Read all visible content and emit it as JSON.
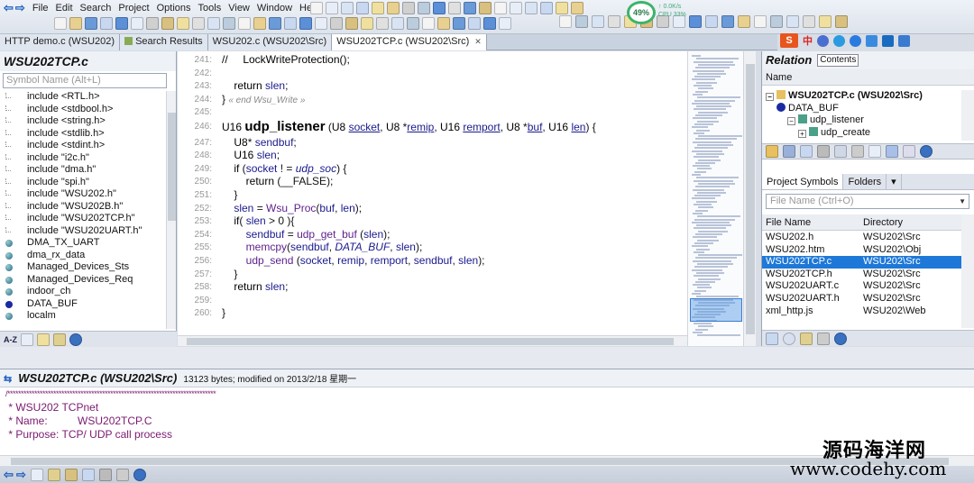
{
  "menu": [
    "File",
    "Edit",
    "Search",
    "Project",
    "Options",
    "Tools",
    "View",
    "Window",
    "Help"
  ],
  "gauge": {
    "percent": "49%",
    "net_up": "↑ 0.0K/s",
    "cpu": "CPU 33%"
  },
  "tabs": [
    {
      "label": "HTTP demo.c (WSU202)",
      "active": false,
      "has_icon": false
    },
    {
      "label": "Search Results",
      "active": false,
      "has_icon": true
    },
    {
      "label": "WSU202.c (WSU202\\Src)",
      "active": false,
      "has_icon": false
    },
    {
      "label": "WSU202TCP.c (WSU202\\Src)",
      "active": true,
      "has_icon": false
    }
  ],
  "symbol_panel": {
    "title": "WSU202TCP.c",
    "search_placeholder": "Symbol Name (Alt+L)",
    "items": [
      {
        "label": "include <RTL.h>",
        "kind": "inc"
      },
      {
        "label": "include <stdbool.h>",
        "kind": "inc"
      },
      {
        "label": "include <string.h>",
        "kind": "inc"
      },
      {
        "label": "include <stdlib.h>",
        "kind": "inc"
      },
      {
        "label": "include <stdint.h>",
        "kind": "inc"
      },
      {
        "label": "include \"i2c.h\"",
        "kind": "inc"
      },
      {
        "label": "include \"dma.h\"",
        "kind": "inc"
      },
      {
        "label": "include \"spi.h\"",
        "kind": "inc"
      },
      {
        "label": "include \"WSU202.h\"",
        "kind": "inc"
      },
      {
        "label": "include \"WSU202B.h\"",
        "kind": "inc"
      },
      {
        "label": "include \"WSU202TCP.h\"",
        "kind": "inc"
      },
      {
        "label": "include \"WSU202UART.h\"",
        "kind": "inc"
      },
      {
        "label": "DMA_TX_UART",
        "kind": "var"
      },
      {
        "label": "dma_rx_data",
        "kind": "var"
      },
      {
        "label": "Managed_Devices_Sts",
        "kind": "var"
      },
      {
        "label": "Managed_Devices_Req",
        "kind": "var"
      },
      {
        "label": "indoor_ch",
        "kind": "var"
      },
      {
        "label": "DATA_BUF",
        "kind": "fn"
      },
      {
        "label": "localm",
        "kind": "var"
      }
    ],
    "footer_label": "A-Z"
  },
  "editor": {
    "lines": [
      {
        "n": "241:",
        "html": "<span class='kw'>//     LockWriteProtection();</span>"
      },
      {
        "n": "242:",
        "html": ""
      },
      {
        "n": "243:",
        "html": "    <span class='kw'>return</span> <span class='id'>slen</span>;"
      },
      {
        "n": "244:",
        "html": "} <span class='grey'>« end Wsu_Write »</span>"
      },
      {
        "n": "245:",
        "html": ""
      },
      {
        "n": "246:",
        "html": "<span class='kw'>U16</span> <span class='fn-name'>udp_listener</span> (<span class='kw'>U8</span> <span class='pname'>socket</span>, <span class='kw'>U8</span> *<span class='pname'>remip</span>, <span class='kw'>U16</span> <span class='pname'>remport</span>, <span class='kw'>U8</span> *<span class='pname'>buf</span>, <span class='kw'>U16</span> <span class='pname'>len</span>) {"
      },
      {
        "n": "247:",
        "html": "    <span class='kw'>U8</span>* <span class='id'>sendbuf</span>;"
      },
      {
        "n": "248:",
        "html": "    <span class='kw'>U16</span> <span class='id'>slen</span>;"
      },
      {
        "n": "249:",
        "html": "    <span class='kw'>if</span> (<span class='id'>socket</span> ! = <span class='var-i'>udp_soc</span>) {"
      },
      {
        "n": "250:",
        "html": "        <span class='kw'>return</span> (__FALSE);"
      },
      {
        "n": "251:",
        "html": "    }"
      },
      {
        "n": "252:",
        "html": "    <span class='id'>slen</span> = <span class='call'>Wsu_Proc</span>(<span class='id'>buf</span>, <span class='id'>len</span>);"
      },
      {
        "n": "253:",
        "html": "    <span class='kw'>if</span>( <span class='id'>slen</span> &gt; 0 ){"
      },
      {
        "n": "254:",
        "html": "        <span class='id'>sendbuf</span> = <span class='call'>udp_get_buf</span> (<span class='id'>slen</span>);"
      },
      {
        "n": "255:",
        "html": "        <span class='call'>memcpy</span>(<span class='id'>sendbuf</span>, <span class='var-i'>DATA_BUF</span>, <span class='id'>slen</span>);"
      },
      {
        "n": "256:",
        "html": "        <span class='call'>udp_send</span> (<span class='id'>socket</span>, <span class='id'>remip</span>, <span class='id'>remport</span>, <span class='id'>sendbuf</span>, <span class='id'>slen</span>);"
      },
      {
        "n": "257:",
        "html": "    }"
      },
      {
        "n": "258:",
        "html": "    <span class='kw'>return</span> <span class='id'>slen</span>;"
      },
      {
        "n": "259:",
        "html": ""
      },
      {
        "n": "260:",
        "html": "}"
      }
    ]
  },
  "relation": {
    "title": "Relation",
    "contents_label": "Contents",
    "column": "Name",
    "tree": [
      {
        "label": "WSU202TCP.c (WSU202\\Src)",
        "indent": 0,
        "box": "−",
        "bold": true
      },
      {
        "label": "DATA_BUF",
        "indent": 1,
        "box": "",
        "bold": false
      },
      {
        "label": "udp_listener",
        "indent": 2,
        "box": "−",
        "bold": false
      },
      {
        "label": "udp_create",
        "indent": 3,
        "box": "+",
        "bold": false
      }
    ]
  },
  "project": {
    "tabs": [
      "Project Symbols",
      "Folders"
    ],
    "search_placeholder": "File Name (Ctrl+O)",
    "columns": [
      "File Name",
      "Directory"
    ],
    "files": [
      {
        "name": "WSU202.h",
        "dir": "WSU202\\Src",
        "selected": false
      },
      {
        "name": "WSU202.htm",
        "dir": "WSU202\\Obj",
        "selected": false
      },
      {
        "name": "WSU202TCP.c",
        "dir": "WSU202\\Src",
        "selected": true
      },
      {
        "name": "WSU202TCP.h",
        "dir": "WSU202\\Src",
        "selected": false
      },
      {
        "name": "WSU202UART.c",
        "dir": "WSU202\\Src",
        "selected": false
      },
      {
        "name": "WSU202UART.h",
        "dir": "WSU202\\Src",
        "selected": false
      },
      {
        "name": "xml_http.js",
        "dir": "WSU202\\Web",
        "selected": false
      }
    ]
  },
  "context": {
    "title": "WSU202TCP.c (WSU202\\Src)",
    "info": "13123 bytes; modified on 2013/2/18 星期一",
    "lines": [
      "/*****************************************************************************",
      " * WSU202 TCPnet",
      " * Name:          WSU202TCP.C",
      " * Purpose: TCP/ UDP call process"
    ]
  },
  "ime": {
    "s": "S",
    "zh": "中"
  },
  "watermark": {
    "line1": "源码海洋网",
    "line2": "www.codehy.com"
  },
  "colors": {
    "selection": "#1e78d8",
    "gauge": "#3db36a"
  }
}
